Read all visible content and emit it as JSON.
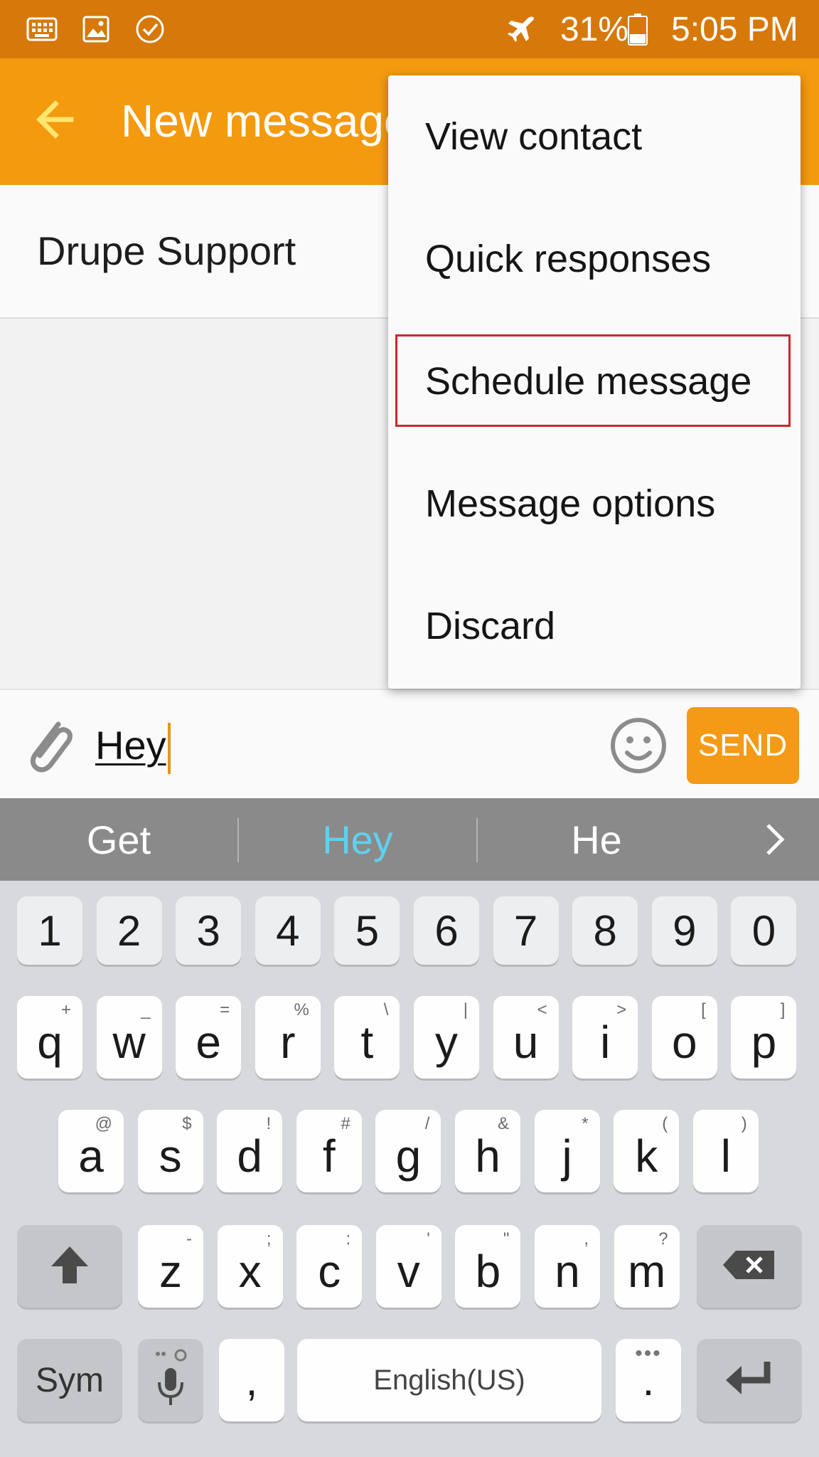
{
  "status_bar": {
    "icons": [
      "keyboard-icon",
      "image-icon",
      "check-circle-icon",
      "airplane-mode-icon",
      "battery-icon"
    ],
    "battery": "31%",
    "time": "5:05 PM"
  },
  "app_bar": {
    "title": "New message",
    "back_icon": "arrow-left-icon"
  },
  "recipient": {
    "name": "Drupe Support"
  },
  "compose": {
    "text": "Hey",
    "send_label": "SEND"
  },
  "suggestions": {
    "items": [
      "Get",
      "Hey",
      "He"
    ],
    "highlight_color": "#5fd1ee"
  },
  "menu": {
    "items": [
      "View contact",
      "Quick responses",
      "Schedule message",
      "Message options",
      "Discard"
    ],
    "highlighted_item": "Schedule message",
    "highlight_color": "#d0262e"
  },
  "keyboard": {
    "numbers": [
      "1",
      "2",
      "3",
      "4",
      "5",
      "6",
      "7",
      "8",
      "9",
      "0"
    ],
    "row1": [
      {
        "key": "q",
        "hint": "+"
      },
      {
        "key": "w",
        "hint": "_"
      },
      {
        "key": "e",
        "hint": "="
      },
      {
        "key": "r",
        "hint": "%"
      },
      {
        "key": "t",
        "hint": "\\"
      },
      {
        "key": "y",
        "hint": "|"
      },
      {
        "key": "u",
        "hint": "<"
      },
      {
        "key": "i",
        "hint": ">"
      },
      {
        "key": "o",
        "hint": "["
      },
      {
        "key": "p",
        "hint": "]"
      }
    ],
    "row2": [
      {
        "key": "a",
        "hint": "@"
      },
      {
        "key": "s",
        "hint": "$"
      },
      {
        "key": "d",
        "hint": "!"
      },
      {
        "key": "f",
        "hint": "#"
      },
      {
        "key": "g",
        "hint": "/"
      },
      {
        "key": "h",
        "hint": "&"
      },
      {
        "key": "j",
        "hint": "*"
      },
      {
        "key": "k",
        "hint": "("
      },
      {
        "key": "l",
        "hint": ")"
      }
    ],
    "row3": [
      {
        "key": "z",
        "hint": "-"
      },
      {
        "key": "x",
        "hint": ";"
      },
      {
        "key": "c",
        "hint": ":"
      },
      {
        "key": "v",
        "hint": "'"
      },
      {
        "key": "b",
        "hint": "\""
      },
      {
        "key": "n",
        "hint": ","
      },
      {
        "key": "m",
        "hint": "?"
      }
    ],
    "sym_label": "Sym",
    "comma_label": ",",
    "space_label": "English(US)",
    "period_label": "."
  },
  "colors": {
    "status_bar": "#d6780a",
    "app_bar": "#f49a0f",
    "send_button": "#f49a16",
    "back_arrow": "#ffe66e"
  }
}
